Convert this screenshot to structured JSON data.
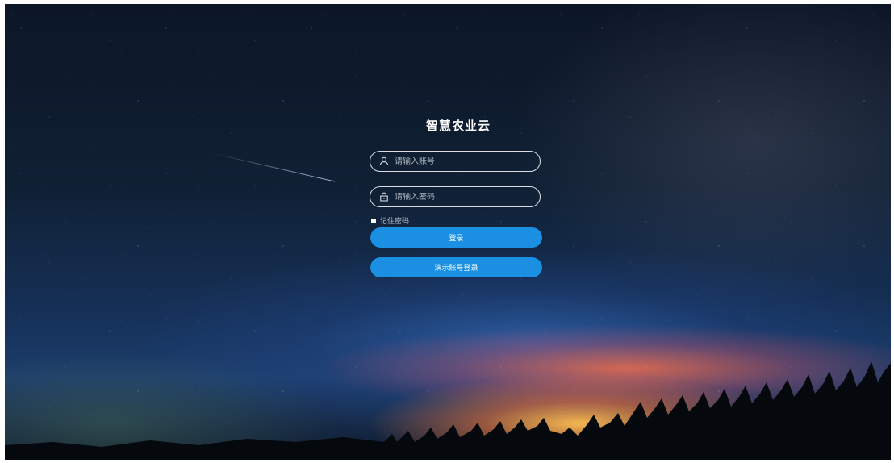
{
  "login": {
    "title": "智慧农业云",
    "username_placeholder": "请输入账号",
    "password_placeholder": "请输入密码",
    "remember_label": "记住密码",
    "login_button": "登录",
    "demo_button": "演示账号登录"
  },
  "icons": {
    "username": "user-icon",
    "password": "lock-icon"
  },
  "colors": {
    "button": "#1b8fe2",
    "field_border": "#ffffff"
  }
}
